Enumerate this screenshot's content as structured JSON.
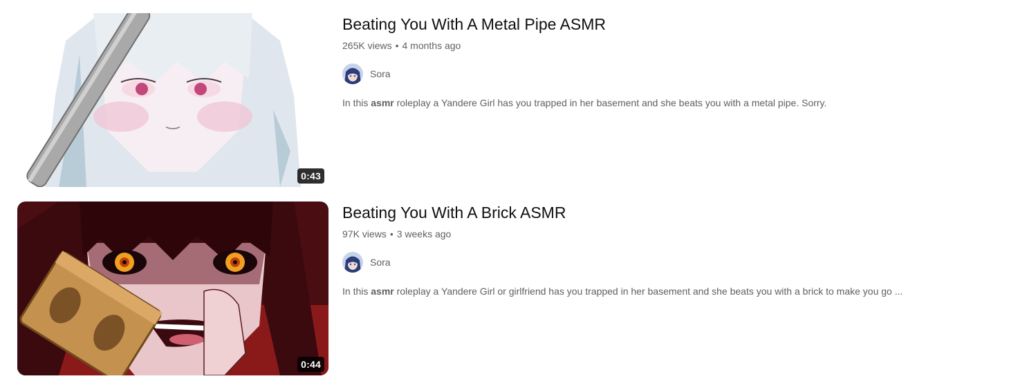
{
  "results": [
    {
      "title": "Beating You With A Metal Pipe ASMR",
      "views": "265K views",
      "age": "4 months ago",
      "channel": "Sora",
      "description_prefix": "In this ",
      "description_highlight": "asmr",
      "description_suffix": " roleplay a Yandere Girl has you trapped in her basement and she beats you with a metal pipe. Sorry.",
      "duration": "0:43"
    },
    {
      "title": "Beating You With A Brick ASMR",
      "views": "97K views",
      "age": "3 weeks ago",
      "channel": "Sora",
      "description_prefix": "In this ",
      "description_highlight": "asmr",
      "description_suffix": " roleplay a Yandere Girl or girlfriend has you trapped in her basement and she beats you with a brick to make you go ...",
      "duration": "0:44"
    }
  ],
  "separator": "•",
  "colors": {
    "meta_text": "#606060",
    "title_text": "#0f0f0f",
    "duration_bg": "#000000"
  }
}
